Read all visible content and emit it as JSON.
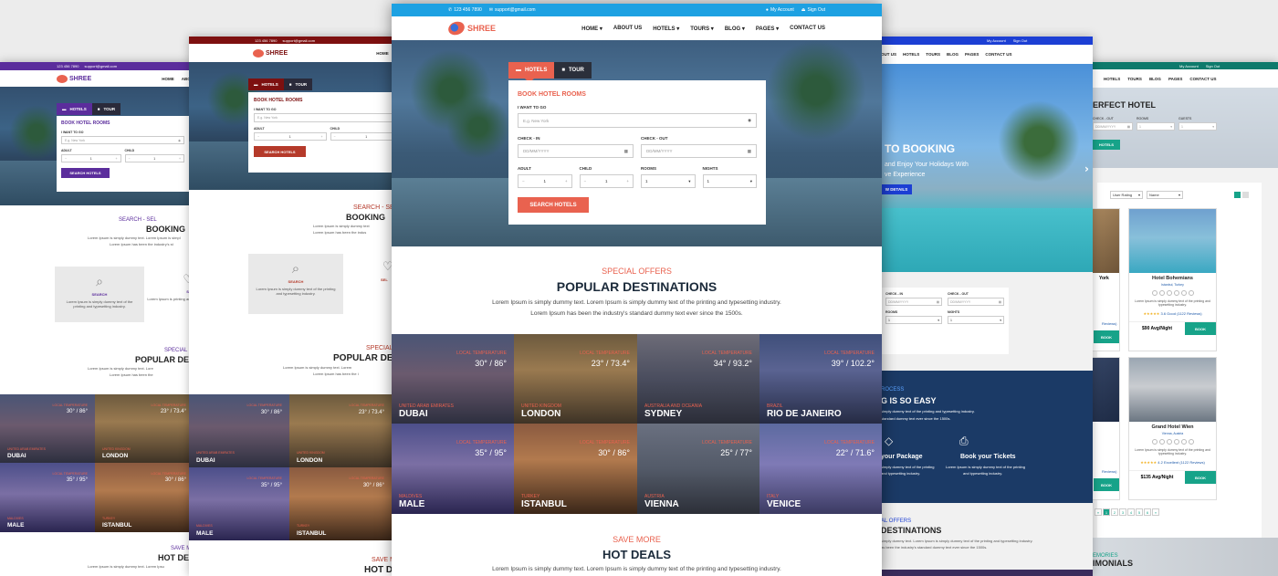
{
  "colors": {
    "main_topbar": "#1da1e2",
    "main_accent": "#e9624f",
    "purple": "#5b2d9c",
    "maroon": "#7d1010",
    "blue_bar": "#1c3fd4",
    "teal": "#0e7a6c",
    "teal_btn": "#17a389",
    "navy": "#1b3a66"
  },
  "main": {
    "topbar": {
      "phone": "123 456 7890",
      "email": "support@gmail.com",
      "account": "My Account",
      "signout": "Sign Out"
    },
    "logo": "SHREE",
    "nav": [
      "HOME",
      "ABOUT US",
      "HOTELS",
      "TOURS",
      "BLOG",
      "PAGES",
      "CONTACT US"
    ],
    "tabs": {
      "hotels": "HOTELS",
      "tour": "TOUR"
    },
    "form": {
      "title": "BOOK HOTEL ROOMS",
      "want": "I WANT TO GO",
      "want_ph": "E.g. New York",
      "checkin": "CHECK - IN",
      "checkout": "CHECK - OUT",
      "date_ph": "DD/MM/YYYY",
      "adult": "ADULT",
      "child": "CHILD",
      "rooms": "ROOMS",
      "nights": "NIGHTS",
      "adult_val": "1",
      "child_val": "1",
      "rooms_val": "1",
      "nights_val": "1",
      "button": "SEARCH HOTELS"
    },
    "special": {
      "pre": "SPECIAL OFFERS",
      "title": "POPULAR DESTINATIONS",
      "desc1": "Lorem Ipsum is simply dummy text. Lorem Ipsum is simply dummy text of the printing and typesetting industry.",
      "desc2": "Lorem Ipsum has been the industry's standard dummy text ever since the 1500s."
    },
    "cities": [
      {
        "label": "LOCAL TEMPERATURE",
        "temp": "30° / 86°",
        "country": "UNITED ARAB EMIRATES",
        "name": "DUBAI"
      },
      {
        "label": "LOCAL TEMPERATURE",
        "temp": "23° / 73.4°",
        "country": "UNITED KINGDOM",
        "name": "LONDON"
      },
      {
        "label": "LOCAL TEMPERATURE",
        "temp": "34° / 93.2°",
        "country": "AUSTRALIA AND OCEANIA",
        "name": "SYDNEY"
      },
      {
        "label": "LOCAL TEMPERATURE",
        "temp": "39° / 102.2°",
        "country": "BRAZIL",
        "name": "RIO DE JANEIRO"
      },
      {
        "label": "LOCAL TEMPERATURE",
        "temp": "35° / 95°",
        "country": "MALDIVES",
        "name": "MALE"
      },
      {
        "label": "LOCAL TEMPERATURE",
        "temp": "30° / 86°",
        "country": "TURKEY",
        "name": "ISTANBUL"
      },
      {
        "label": "LOCAL TEMPERATURE",
        "temp": "25° / 77°",
        "country": "AUSTRIA",
        "name": "VIENNA"
      },
      {
        "label": "LOCAL TEMPERATURE",
        "temp": "22° / 71.6°",
        "country": "ITALY",
        "name": "VENICE"
      }
    ],
    "save": {
      "pre": "SAVE MORE",
      "title": "HOT DEALS",
      "desc": "Lorem Ipsum is simply dummy text. Lorem Ipsum is simply dummy text of the printing and typesetting industry."
    }
  },
  "p2": {
    "topbar": {
      "phone": "123 456 7890",
      "email": "support@gmail.com"
    },
    "logo": "SHREE",
    "nav": [
      "HOME",
      "ABOU"
    ],
    "tabs": {
      "hotels": "HOTELS",
      "tour": "TOUR"
    },
    "form": {
      "title": "BOOK HOTEL ROOMS",
      "want": "I WANT TO GO",
      "want_ph": "E.g. New York",
      "adult": "ADULT",
      "child": "CHILD",
      "val": "1",
      "button": "SEARCH HOTELS"
    },
    "step": {
      "pre": "SEARCH - SEL",
      "title": "BOOKING",
      "desc1": "Lorem Ipsum is simply dummy text",
      "desc2": "Lorem Ipsum has been the indus",
      "search": "SEARCH",
      "search_desc": "Lorem Ipsum is simply dummy text of the printing and typesetting industry.",
      "sel": "SEL"
    },
    "special": {
      "pre": "SPECIAL",
      "title": "POPULAR DES",
      "desc1": "Lorem Ipsum is simply dummy text. Lorem",
      "desc2": "Lorem Ipsum has been the i"
    },
    "cities": [
      {
        "label": "LOCAL TEMPERATURE",
        "temp": "30° / 86°",
        "country": "UNITED ARAB EMIRATES",
        "name": "DUBAI"
      },
      {
        "label": "LOCAL TEMPERATURE",
        "temp": "23° / 73.4°",
        "country": "UNITED KINGDOM",
        "name": "LONDON"
      },
      {
        "label": "LOCAL TEMPERATURE",
        "temp": "35° / 95°",
        "country": "MALDIVES",
        "name": "MALE"
      },
      {
        "label": "LOCAL TEMPERATURE",
        "temp": "30° / 86°",
        "country": "TURKEY",
        "name": "ISTANBUL"
      }
    ],
    "save": {
      "pre": "SAVE M",
      "title": "HOT D"
    }
  },
  "p1": {
    "topbar": {
      "phone": "123 456 7890",
      "email": "support@gmail.com"
    },
    "logo": "SHREE",
    "nav": [
      "HOME",
      "ABOU"
    ],
    "tabs": {
      "hotels": "HOTELS",
      "tour": "TOUR"
    },
    "form": {
      "title": "BOOK HOTEL ROOMS",
      "want": "I WANT TO GO",
      "want_ph": "E.g. New York",
      "adult": "ADULT",
      "child": "CHILD",
      "val": "1",
      "button": "SEARCH HOTELS"
    },
    "step": {
      "pre": "SEARCH - SEL",
      "title": "BOOKING",
      "desc1": "Lorem Ipsum is simply dummy text. Lorem Ipsum is simpl",
      "desc2": "Lorem Ipsum has been the industry's st",
      "search": "SEARCH",
      "search_desc": "Lorem Ipsum is simply dummy text of the printing and typesetting industry.",
      "sel": "SEL",
      "sel_desc": "Lorem Ipsum is printing and"
    },
    "special": {
      "pre": "SPECIAL",
      "title": "POPULAR DE",
      "desc1": "Lorem Ipsum is simply dummy text. Lore",
      "desc2": "Lorem Ipsum has been the"
    },
    "cities": [
      {
        "label": "LOCAL TEMPERATURE",
        "temp": "30° / 86°",
        "country": "UNITED ARAB EMIRATES",
        "name": "DUBAI"
      },
      {
        "label": "LOCAL TEMPERATURE",
        "temp": "23° / 73.4°",
        "country": "UNITED KINGDOM",
        "name": "LONDON"
      },
      {
        "label": "LOCAL TEMPERATURE",
        "temp": "35° / 95°",
        "country": "MALDIVES",
        "name": "MALE"
      },
      {
        "label": "LOCAL TEMPERATURE",
        "temp": "30° / 86°",
        "country": "TURKEY",
        "name": "ISTANBUL"
      }
    ],
    "save": {
      "pre": "SAVE M",
      "title": "HOT DE",
      "desc": "Lorem Ipsum is simply dummy text. Lorem Ipsu"
    }
  },
  "p4": {
    "topbar": {
      "account": "My Account",
      "signout": "Sign Out"
    },
    "nav": [
      "OUT US",
      "HOTELS",
      "TOURS",
      "BLOG",
      "PAGES",
      "CONTACT US"
    ],
    "hero": {
      "title": "TO BOOKING",
      "line1": "and Enjoy Your Holidays With",
      "line2": "ve Experience",
      "button": "W DETAILS"
    },
    "form": {
      "checkin": "CHECK - IN",
      "checkout": "CHECK - OUT",
      "date_ph": "DD/MM/YYYY",
      "rooms": "ROOMS",
      "nights": "NIGHTS",
      "val": "1"
    },
    "process": {
      "pre": "ROCESS",
      "title": "G IS SO EASY",
      "desc1": "simply dummy text of the printing and typesetting industry.",
      "desc2": "standard dummy text ever since the 1500s.",
      "s1": "your Package",
      "s1d1": "simply dummy text of the printing",
      "s1d2": "and typesetting industry.",
      "s2": "Book your Tickets",
      "s2d1": "Lorem Ipsum is simply dummy text of the printing",
      "s2d2": "and typesetting industry."
    },
    "special": {
      "pre": "AL OFFERS",
      "title": "DESTINATIONS",
      "desc1": "simply dummy text. Lorem Ipsum is simply dummy text of the printing and typesetting industry.",
      "desc2": "as been the industry's standard dummy text ever since the 1500s."
    }
  },
  "p5": {
    "topbar": {
      "account": "My Account",
      "signout": "Sign Out"
    },
    "nav": [
      "HOTELS",
      "TOURS",
      "BLOG",
      "PAGES",
      "CONTACT US"
    ],
    "hero": {
      "title": "ERFECT HOTEL",
      "checkout": "CHECK - OUT",
      "rooms": "ROOMS",
      "guests": "GUESTS",
      "date_ph": "DD/MM/YYYY",
      "val": "1",
      "button": "HOTELS"
    },
    "filters": {
      "rating": "User Rating",
      "name": "Name"
    },
    "left_cards": [
      {
        "title": "York",
        "reviews": "Reviews)",
        "book": "BOOK"
      },
      {
        "title": "",
        "reviews": "Reviews)",
        "book": "BOOK"
      }
    ],
    "cards": [
      {
        "title": "Hotel Bohemians",
        "loc": "Istanbul, Turkey",
        "desc": "Lorem Ipsum is simply dummy text of the printing and typesetting industry.",
        "stars": "★★★★★",
        "rating": "3.6 Good (1122 Reviews)",
        "price": "$90 Avg/Night",
        "book": "BOOK"
      },
      {
        "title": "Grand Hotel Wien",
        "loc": "Vienna, Austria",
        "desc": "Lorem Ipsum is simply dummy text of the printing and typesetting industry.",
        "stars": "★★★★★",
        "rating": "4.2 Excellent (1122 Reviews)",
        "price": "$135 Avg/Night",
        "book": "BOOK"
      }
    ],
    "pagination": [
      "«",
      "1",
      "2",
      "3",
      "4",
      "5",
      "6",
      "»"
    ],
    "footer": {
      "pre": "EMORIES",
      "title": "IMONIALS"
    }
  }
}
